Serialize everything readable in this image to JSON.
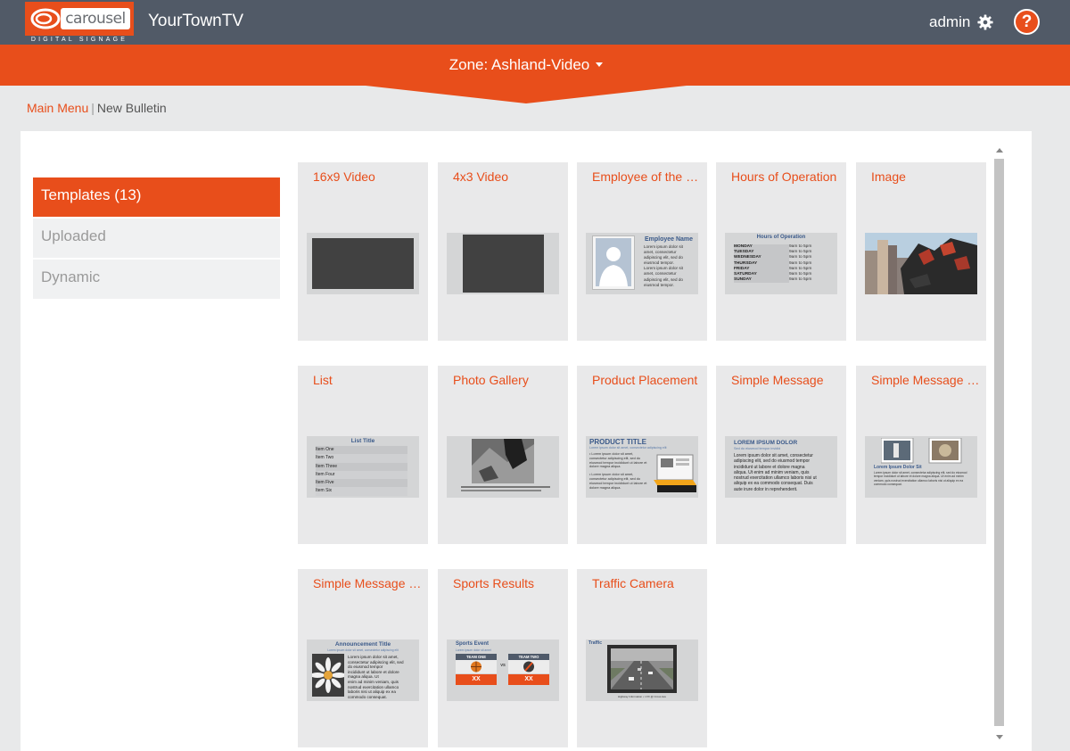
{
  "header": {
    "logo_text": "carousel",
    "logo_sub": "DIGITAL SIGNAGE",
    "app_title": "YourTownTV",
    "user": "admin",
    "help_label": "?"
  },
  "zone": {
    "label": "Zone: Ashland-Video"
  },
  "breadcrumb": {
    "main": "Main Menu",
    "separator": "|",
    "current": "New Bulletin"
  },
  "sidebar": {
    "items": [
      {
        "label": "Templates (13)",
        "active": true
      },
      {
        "label": "Uploaded",
        "active": false
      },
      {
        "label": "Dynamic",
        "active": false
      }
    ]
  },
  "templates": [
    {
      "title": "16x9 Video",
      "thumb": "video-16x9"
    },
    {
      "title": "4x3 Video",
      "thumb": "video-4x3"
    },
    {
      "title": "Employee of the Month",
      "thumb": "employee"
    },
    {
      "title": "Hours of Operation",
      "thumb": "hours"
    },
    {
      "title": "Image",
      "thumb": "image"
    },
    {
      "title": "List",
      "thumb": "list"
    },
    {
      "title": "Photo Gallery",
      "thumb": "gallery"
    },
    {
      "title": "Product Placement",
      "thumb": "product"
    },
    {
      "title": "Simple Message",
      "thumb": "simple"
    },
    {
      "title": "Simple Message with Photos",
      "thumb": "simple-photos"
    },
    {
      "title": "Simple Message with Photo",
      "thumb": "announcement"
    },
    {
      "title": "Sports Results",
      "thumb": "sports"
    },
    {
      "title": "Traffic Camera",
      "thumb": "traffic"
    }
  ],
  "thumb_text": {
    "employee": {
      "name": "Employee Name",
      "body": [
        "Lorem ipsum dolor sit",
        "amet, consectetur",
        "adipiscing elit, sed do",
        "eiusmod tempor.",
        "Lorem ipsum dolor sit",
        "amet, consectetur",
        "adipiscing elit, sed do",
        "eiusmod tempor."
      ]
    },
    "hours": {
      "title": "Hours of Operation",
      "days": [
        "MONDAY",
        "TUESDAY",
        "WEDNESDAY",
        "THURSDAY",
        "FRIDAY",
        "SATURDAY",
        "SUNDAY"
      ],
      "time": "9am to 5pm"
    },
    "list": {
      "title": "List Title",
      "items": [
        "Item One",
        "Item Two",
        "Item Three",
        "Item Four",
        "Item Five",
        "Item Six"
      ]
    },
    "product": {
      "title": "PRODUCT TITLE",
      "subtitle": "Lorem ipsum dolor sit amet, consectetur adipiscing elit",
      "body": [
        "• Lorem ipsum dolor sit amet,",
        "consectetur adipiscing elit, sed do",
        "eiusmod tempor incididunt ut labore et",
        "dolore magna aliqua.",
        "",
        "• Lorem ipsum dolor sit amet,",
        "consectetur adipiscing elit, sed do",
        "eiusmod tempor incididunt ut labore et",
        "dolore magna aliqua."
      ]
    },
    "simple": {
      "title": "LOREM IPSUM DOLOR",
      "subtitle": "Sed do eiusmod tempor invidid",
      "body": [
        "Lorem ipsum dolor sit amet, consectetur",
        "adipiscing elit, sed do eiusmod tempor",
        "incididunt ut labore et dolore magna",
        "aliqua. Ut enim ad minim veniam, quis",
        "nostrud exercitation ullamco laboris nisi ut",
        "aliquip ex ea commodo consequat. Duis",
        "aute irure dolor in reprehenderit."
      ]
    },
    "simple_photos": {
      "title": "Lorem Ipsum Dolor Sit",
      "body": [
        "Lorem ipsum dolor sit amet, consectetur adipiscing elit, sed do eiusmod",
        "tempor incididunt ut labore et dolore magna aliqua. Ut enim ad minim",
        "veniam, quis nostrud exercitation ullamco laboris nisi ut aliquip ex ea",
        "commodo consequat."
      ]
    },
    "announcement": {
      "title": "Announcement Title",
      "subtitle": "Lorem ipsum dolor sit amet, consectetur adipiscing elit",
      "body": [
        "Lorem ipsum dolor sit amet,",
        "consectetur adipiscing elit, sed",
        "do eiusmod tempor",
        "incididunt ut labore et dolore",
        "magna aliqua. Ut",
        "enim ad minim veniam, quis",
        "nostrud exercitation ullamco",
        "laboris nisi ut aliquip ex ea",
        "commodo consequat."
      ]
    },
    "sports": {
      "title": "Sports Event",
      "subtitle": "Lorem ipsum dolor sit amet",
      "team_one": "TEAM ONE",
      "team_two": "TEAM TWO",
      "vs": "VS",
      "score": "XX"
    },
    "traffic": {
      "title": "Traffic",
      "caption": "Highway Information • I-XX @ Cross Ave"
    }
  },
  "colors": {
    "accent": "#e84e1b",
    "header": "#515a67",
    "tile": "#e9e9ea",
    "thumb_text": "#3b5a8a"
  }
}
